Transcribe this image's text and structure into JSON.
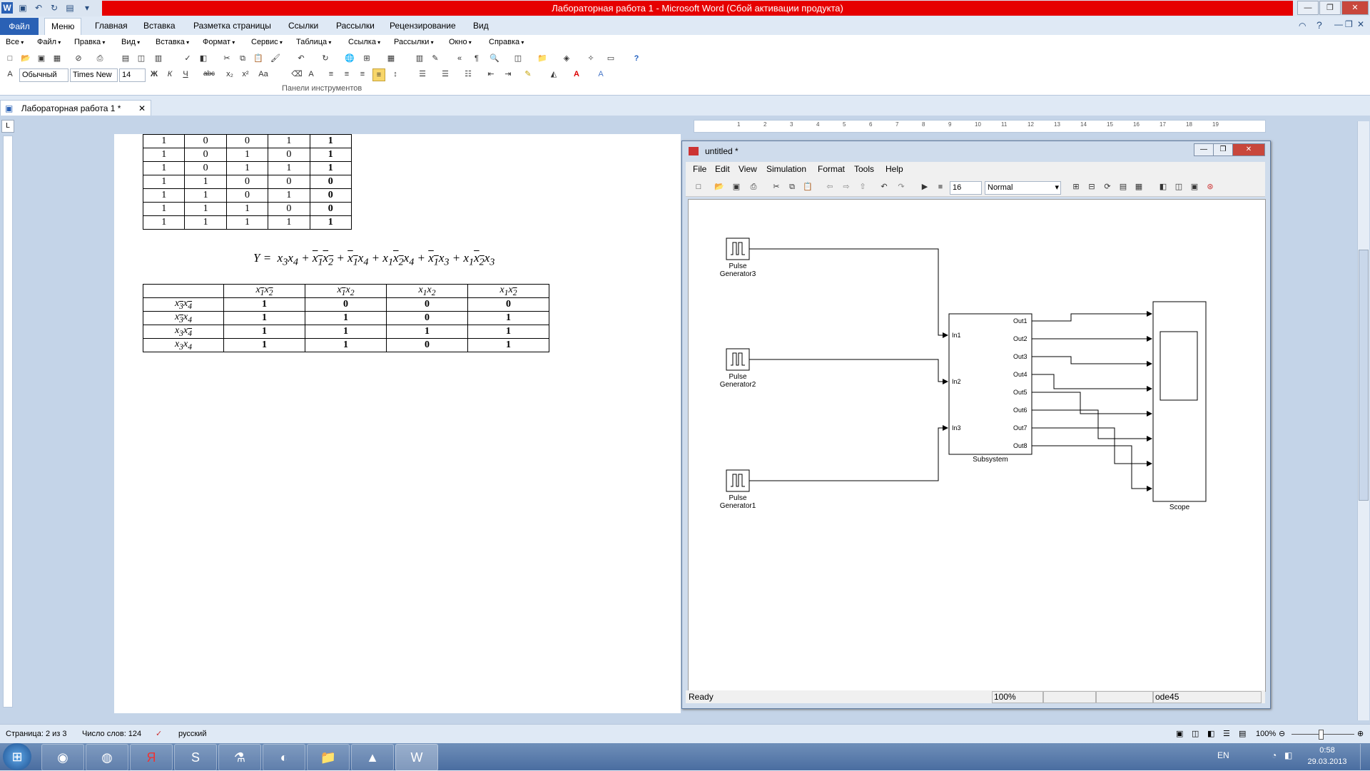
{
  "word": {
    "title": "Лабораторная работа 1  -  Microsoft Word (Сбой активации продукта)",
    "file_tab": "Файл",
    "tabs": [
      "Меню",
      "Главная",
      "Вставка",
      "Разметка страницы",
      "Ссылки",
      "Рассылки",
      "Рецензирование",
      "Вид"
    ],
    "menu": [
      "Все",
      "Файл",
      "Правка",
      "Вид",
      "Вставка",
      "Формат",
      "Сервис",
      "Таблица",
      "Ссылка",
      "Рассылки",
      "Окно",
      "Справка"
    ],
    "style_value": "Обычный",
    "font_value": "Times New",
    "size_value": "14",
    "format_buttons": [
      "Ж",
      "К",
      "Ч",
      "abc",
      "x₂",
      "x²",
      "Aa"
    ],
    "group_label": "Панели инструментов",
    "doc_tab": "Лабораторная работа 1  *",
    "ruler_numbers": [
      "1",
      "2",
      "3",
      "4",
      "5",
      "6",
      "7",
      "8",
      "9",
      "10",
      "11",
      "12",
      "13",
      "14",
      "15",
      "16",
      "17",
      "18",
      "19"
    ],
    "truth_rows": [
      [
        "1",
        "0",
        "0",
        "1",
        "1"
      ],
      [
        "1",
        "0",
        "1",
        "0",
        "1"
      ],
      [
        "1",
        "0",
        "1",
        "1",
        "1"
      ],
      [
        "1",
        "1",
        "0",
        "0",
        "0"
      ],
      [
        "1",
        "1",
        "0",
        "1",
        "0"
      ],
      [
        "1",
        "1",
        "1",
        "0",
        "0"
      ],
      [
        "1",
        "1",
        "1",
        "1",
        "1"
      ]
    ],
    "kmap": {
      "rows": [
        [
          "1",
          "0",
          "0",
          "0"
        ],
        [
          "1",
          "1",
          "0",
          "1"
        ],
        [
          "1",
          "1",
          "1",
          "1"
        ],
        [
          "1",
          "1",
          "0",
          "1"
        ]
      ]
    },
    "status": {
      "page": "Страница: 2 из 3",
      "words": "Число слов: 124",
      "lang": "русский",
      "zoom": "100%"
    }
  },
  "simulink": {
    "title": "untitled *",
    "menu": [
      "File",
      "Edit",
      "View",
      "Simulation",
      "Format",
      "Tools",
      "Help"
    ],
    "stop_time": "16",
    "sim_mode": "Normal",
    "blocks": {
      "pg3": "Pulse\nGenerator3",
      "pg2": "Pulse\nGenerator2",
      "pg1": "Pulse\nGenerator1",
      "subsystem": "Subsystem",
      "scope": "Scope"
    },
    "inports": [
      "In1",
      "In2",
      "In3"
    ],
    "outports": [
      "Out1",
      "Out2",
      "Out3",
      "Out4",
      "Out5",
      "Out6",
      "Out7",
      "Out8"
    ],
    "status": {
      "ready": "Ready",
      "zoom": "100%",
      "solver": "ode45"
    }
  },
  "taskbar": {
    "lang": "EN",
    "time": "0:58",
    "date": "29.03.2013"
  },
  "colors": {
    "titlebar_accent": "#e60000",
    "file_tab": "#2a61b5"
  }
}
